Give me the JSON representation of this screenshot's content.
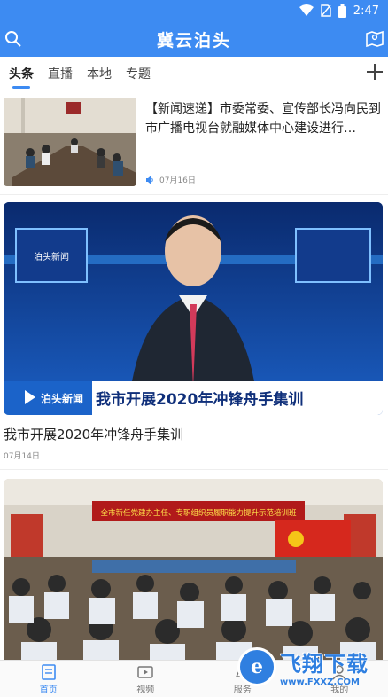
{
  "status": {
    "time": "2:47"
  },
  "app": {
    "title": "冀云泊头",
    "accent": "#3d8bf2",
    "left_icon": "search-icon",
    "right_icon": "map-icon"
  },
  "tabs": [
    {
      "label": "头条",
      "active": true
    },
    {
      "label": "直播"
    },
    {
      "label": "本地"
    },
    {
      "label": "专题"
    }
  ],
  "news": [
    {
      "title": "【新闻速递】市委常委、宣传部长冯向民到市广播电视台就融媒体中心建设进行…",
      "date": "07月16日",
      "icon": "audio-icon"
    },
    {
      "title": "我市开展2020年冲锋舟手集训",
      "date": "07月14日",
      "video_logo": "泊头新闻",
      "video_caption": "我市开展2020年冲锋舟手集训",
      "screen_label": "泊头新闻"
    },
    {
      "banner": "全市新任党建办主任、专职组织员履职能力提升示范培训班"
    }
  ],
  "nav": [
    {
      "label": "首页",
      "icon": "home-icon",
      "active": true
    },
    {
      "label": "视频",
      "icon": "video-icon"
    },
    {
      "label": "服务",
      "icon": "service-icon"
    },
    {
      "label": "我的",
      "icon": "profile-icon"
    }
  ],
  "watermark": {
    "text": "飞翔下载",
    "url": "www.FXXZ.COM"
  }
}
